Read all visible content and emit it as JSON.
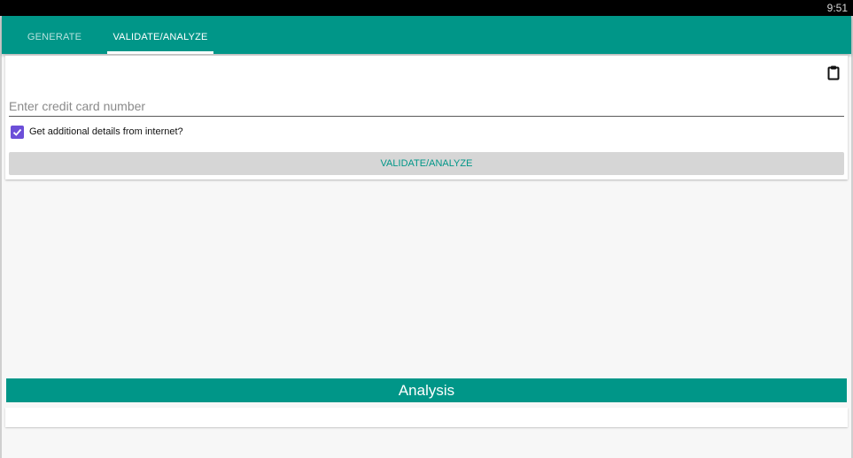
{
  "status_bar": {
    "time": "9:51"
  },
  "tabs": [
    {
      "label": "GENERATE",
      "selected": false
    },
    {
      "label": "VALIDATE/ANALYZE",
      "selected": true
    }
  ],
  "form": {
    "paste_icon": "clipboard-icon",
    "card_input": {
      "placeholder": "Enter credit card number",
      "value": ""
    },
    "details_checkbox": {
      "label": "Get additional details from internet?",
      "checked": true
    },
    "validate_button": "VALIDATE/ANALYZE"
  },
  "analysis": {
    "title": "Analysis"
  },
  "colors": {
    "primary": "#009688",
    "accent": "#6c4fd8",
    "button_bg": "#d6d6d6",
    "background": "#f7f7f7"
  }
}
